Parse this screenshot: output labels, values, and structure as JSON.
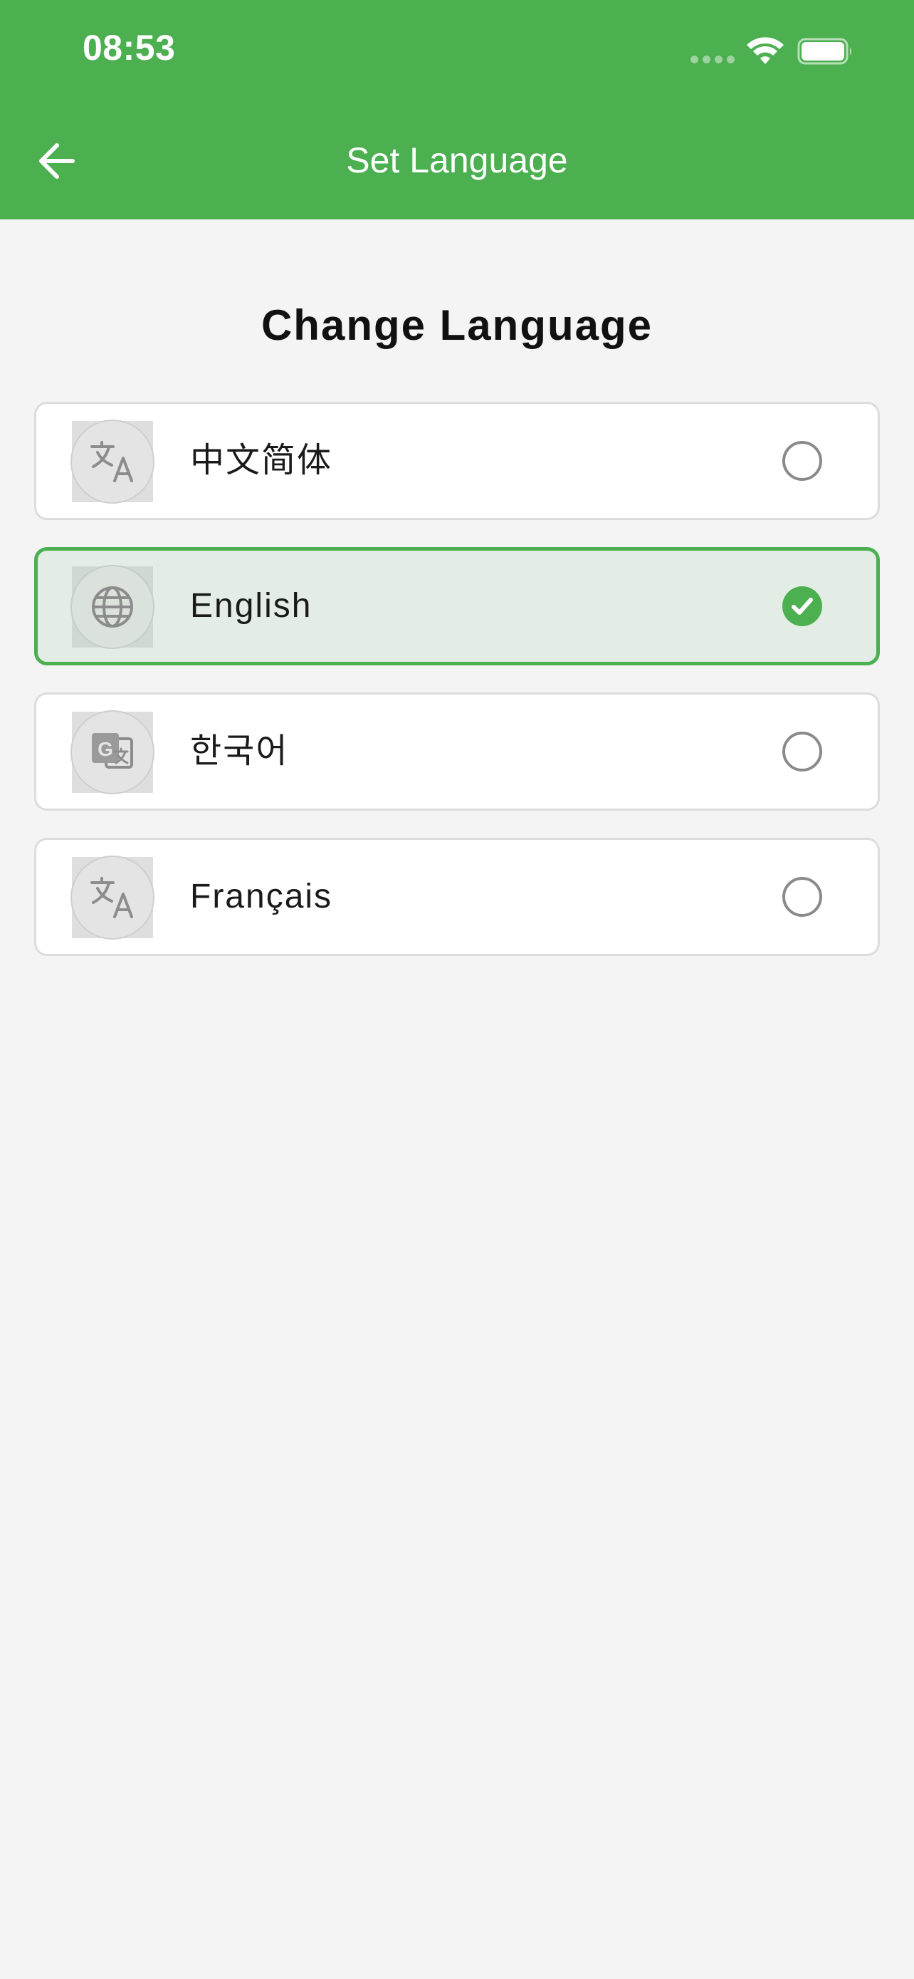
{
  "status_bar": {
    "time": "08:53",
    "signal_icon": "cellular-dots-icon",
    "wifi_icon": "wifi-icon",
    "battery_icon": "battery-full-icon"
  },
  "app_bar": {
    "title": "Set Language",
    "back_icon": "arrow-left-icon",
    "background_color": "#4caf50"
  },
  "page": {
    "heading": "Change Language"
  },
  "languages": [
    {
      "label": "中文简体",
      "icon": "translate-icon",
      "selected": false
    },
    {
      "label": "English",
      "icon": "globe-icon",
      "selected": true
    },
    {
      "label": "한국어",
      "icon": "google-translate-icon",
      "selected": false
    },
    {
      "label": "Français",
      "icon": "translate-icon",
      "selected": false
    }
  ],
  "colors": {
    "accent": "#4caf50",
    "selected_background": "#e3ede5",
    "page_background": "#f4f4f4"
  }
}
